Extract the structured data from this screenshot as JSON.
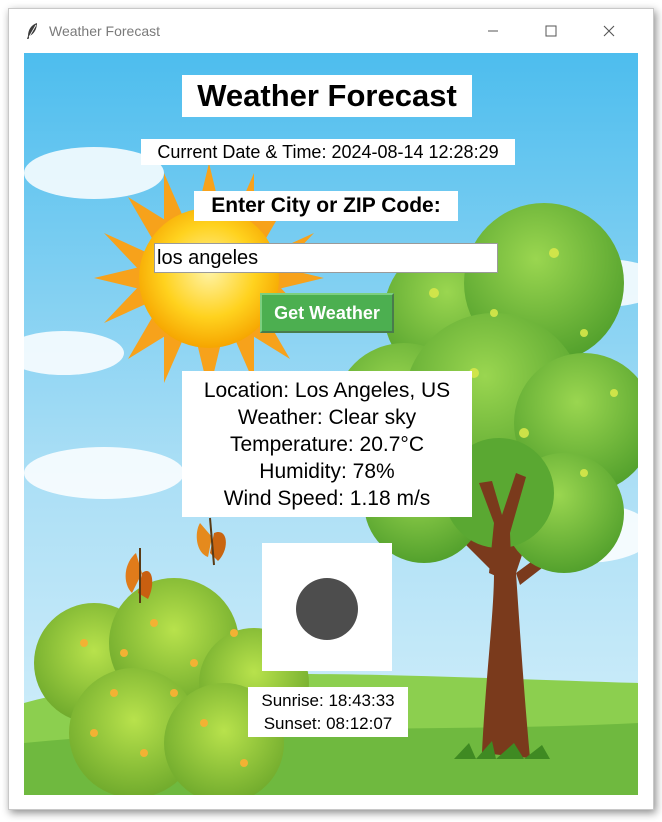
{
  "window": {
    "title": "Weather Forecast",
    "app_icon": "feather-icon",
    "controls": [
      "minimize-icon",
      "maximize-icon",
      "close-icon"
    ]
  },
  "header": {
    "title": "Weather Forecast",
    "datetime": "Current Date & Time: 2024-08-14 12:28:29"
  },
  "search": {
    "prompt": "Enter City or ZIP Code:",
    "value": "los angeles",
    "button_label": "Get Weather"
  },
  "result": {
    "location": "Location: Los Angeles, US",
    "weather": "Weather: Clear sky",
    "temperature": "Temperature: 20.7°C",
    "humidity": "Humidity: 78%",
    "wind": "Wind Speed: 1.18 m/s"
  },
  "weather_icon": {
    "name": "clear-sky-icon",
    "color": "#4d4d4d"
  },
  "sun_times": {
    "sunrise": "Sunrise: 18:43:33",
    "sunset": "Sunset: 08:12:07"
  },
  "colors": {
    "button": "#4caf50",
    "sky": "#5bc3ee",
    "grass": "#7cc84a"
  }
}
